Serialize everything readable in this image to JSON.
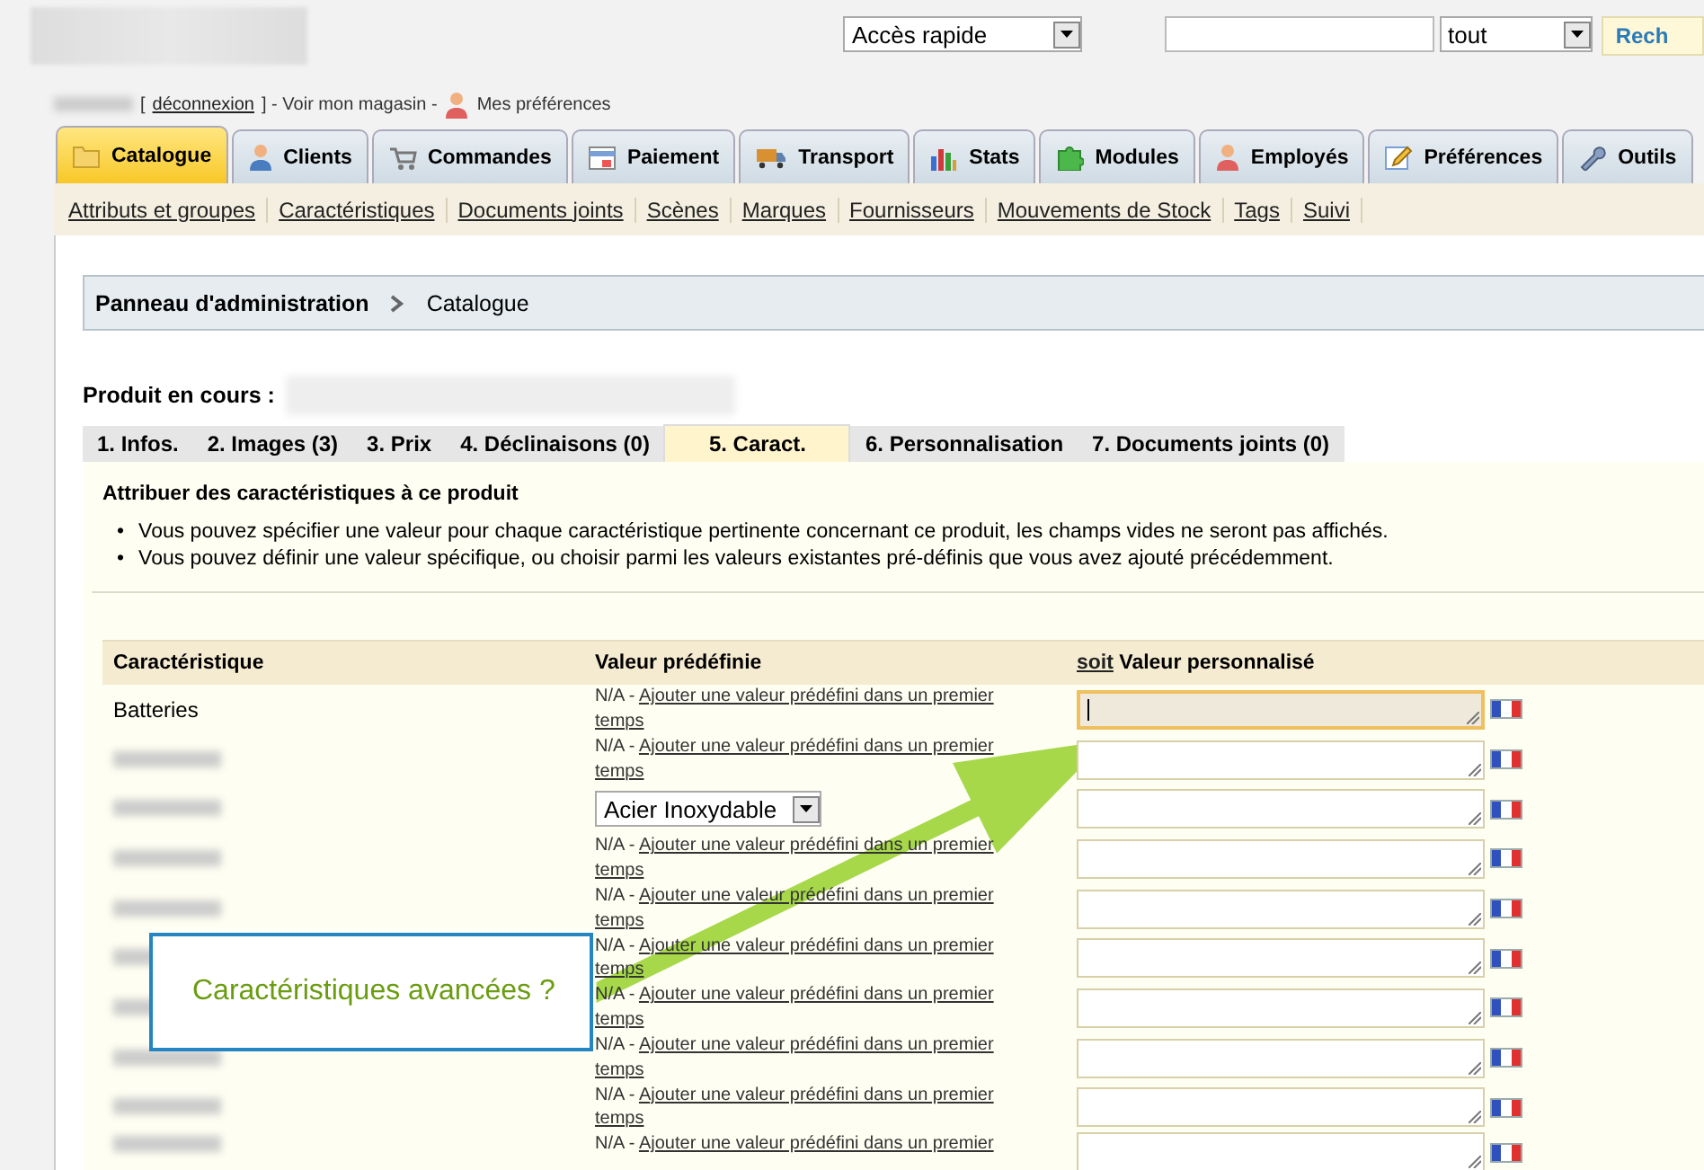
{
  "header": {
    "quick_access": {
      "value": "Accès rapide"
    },
    "search": {
      "scope": "tout",
      "button": "Rech"
    },
    "user_bar": {
      "logout": "déconnexion",
      "bracket_open": "[",
      "after_logout": "] - Voir mon magasin -",
      "preferences": "Mes préférences"
    }
  },
  "main_tabs": [
    {
      "label": "Catalogue",
      "selected": true
    },
    {
      "label": "Clients",
      "selected": false
    },
    {
      "label": "Commandes",
      "selected": false
    },
    {
      "label": "Paiement",
      "selected": false
    },
    {
      "label": "Transport",
      "selected": false
    },
    {
      "label": "Stats",
      "selected": false
    },
    {
      "label": "Modules",
      "selected": false
    },
    {
      "label": "Employés",
      "selected": false
    },
    {
      "label": "Préférences",
      "selected": false
    },
    {
      "label": "Outils",
      "selected": false
    }
  ],
  "sub_nav": [
    "Attributs et groupes",
    "Caractéristiques",
    "Documents joints",
    "Scènes",
    "Marques",
    "Fournisseurs",
    "Mouvements de Stock",
    "Tags",
    "Suivi"
  ],
  "breadcrumb": [
    "Panneau d'administration",
    "Catalogue"
  ],
  "product_label": "Produit en cours :",
  "product_tabs": [
    {
      "label": "1. Infos.",
      "selected": false
    },
    {
      "label": "2. Images (3)",
      "selected": false
    },
    {
      "label": "3. Prix",
      "selected": false
    },
    {
      "label": "4. Déclinaisons (0)",
      "selected": false
    },
    {
      "label": "5. Caract.",
      "selected": true
    },
    {
      "label": "6. Personnalisation",
      "selected": false
    },
    {
      "label": "7. Documents joints (0)",
      "selected": false
    }
  ],
  "section_title": "Attribuer des caractéristiques à ce produit",
  "notes": [
    {
      "bullet": "•",
      "text": "Vous pouvez spécifier une valeur pour chaque caractéristique pertinente concernant ce produit, les champs vides ne seront pas affichés."
    },
    {
      "bullet": "•",
      "text": "Vous pouvez définir une valeur spécifique, ou choisir parmi les valeurs existantes pré-définis que vous avez ajouté précédemment."
    }
  ],
  "table": {
    "columns": [
      {
        "label": "Caractéristique"
      },
      {
        "label": "Valeur prédéfinie"
      },
      {
        "link": "soit",
        "label": "Valeur personnalisé"
      }
    ],
    "rows": [
      {
        "name": "Batteries",
        "blurred": false,
        "kind": "none",
        "na": "N/A -",
        "link": "Ajouter une valeur prédéfini dans un premier temps",
        "focused": true
      },
      {
        "blurred": true,
        "kind": "none",
        "na": "N/A -",
        "link": "Ajouter une valeur prédéfini dans un premier temps",
        "focused": false
      },
      {
        "blurred": true,
        "kind": "select",
        "value": "Acier Inoxydable",
        "focused": false
      },
      {
        "blurred": true,
        "kind": "none",
        "na": "N/A -",
        "link": "Ajouter une valeur prédéfini dans un premier temps",
        "focused": false
      },
      {
        "blurred": true,
        "kind": "none",
        "na": "N/A -",
        "link": "Ajouter une valeur prédéfini dans un premier temps",
        "focused": false
      },
      {
        "blurred": true,
        "kind": "none",
        "na": "N/A -",
        "link": "Ajouter une valeur prédéfini dans un premier temps",
        "focused": false
      },
      {
        "blurred": true,
        "kind": "none",
        "na": "N/A -",
        "link": "Ajouter une valeur prédéfini dans un premier temps",
        "focused": false
      },
      {
        "blurred": true,
        "kind": "none",
        "na": "N/A -",
        "link": "Ajouter une valeur prédéfini dans un premier temps",
        "focused": false
      },
      {
        "blurred": true,
        "kind": "none",
        "na": "N/A -",
        "link": "Ajouter une valeur prédéfini dans un premier temps",
        "focused": false
      },
      {
        "blurred": true,
        "kind": "none",
        "na": "N/A -",
        "link": "Ajouter une valeur prédéfini dans un premier",
        "focused": false
      }
    ]
  },
  "callout": {
    "text": "Caractéristiques avancées ?"
  }
}
